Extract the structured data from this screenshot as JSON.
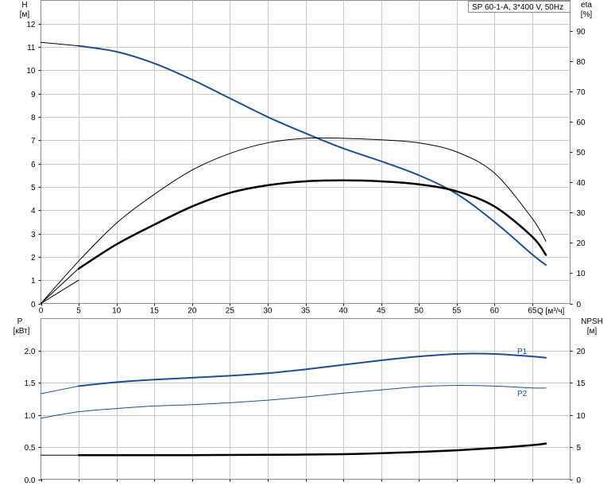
{
  "title": "SP 60-1-A, 3*400 V, 50Hz",
  "colors": {
    "blue": "#1f4e8c",
    "black": "#000000",
    "grid": "#c8c8c8"
  },
  "chart_data": [
    {
      "type": "line",
      "name": "head-efficiency",
      "xlabel": "Q [м³/ч]",
      "ylabel_left": {
        "name": "H",
        "unit": "[м]"
      },
      "ylabel_right": {
        "name": "eta",
        "unit": "[%]"
      },
      "xlim": [
        0,
        70
      ],
      "ylim_left": [
        0,
        13
      ],
      "ylim_right": [
        0,
        100
      ],
      "x_ticks": [
        "0",
        "5",
        "10",
        "15",
        "20",
        "25",
        "30",
        "35",
        "40",
        "45",
        "50",
        "55",
        "60",
        "65"
      ],
      "y_ticks_left": [
        "0",
        "1",
        "2",
        "3",
        "4",
        "5",
        "6",
        "7",
        "8",
        "9",
        "10",
        "11",
        "12"
      ],
      "y_ticks_right": [
        "0",
        "10",
        "20",
        "30",
        "40",
        "50",
        "60",
        "70",
        "80",
        "90"
      ],
      "grid": true,
      "series": [
        {
          "axis": "left",
          "color": "#1f4e8c",
          "width": 2,
          "x": [
            5,
            10,
            15,
            20,
            25,
            30,
            35,
            40,
            45,
            50,
            55,
            60,
            65,
            66.8
          ],
          "y": [
            11.05,
            10.8,
            10.3,
            9.6,
            8.8,
            8.0,
            7.3,
            6.65,
            6.1,
            5.5,
            4.7,
            3.5,
            2.1,
            1.65
          ]
        },
        {
          "axis": "left",
          "color": "#000000",
          "width": 1,
          "x": [
            0,
            5,
            0
          ],
          "y": [
            11.2,
            11.05,
            11.2
          ]
        },
        {
          "axis": "right",
          "color": "#000000",
          "width": 1,
          "x": [
            0,
            5,
            10,
            15,
            20,
            25,
            30,
            35,
            40,
            45,
            50,
            55,
            60,
            65,
            66.8
          ],
          "y": [
            0,
            14,
            26.5,
            36,
            44,
            49.5,
            53,
            54.5,
            54.5,
            54,
            53,
            50,
            43,
            28,
            20.5
          ]
        },
        {
          "axis": "right",
          "color": "#000000",
          "width": 2.5,
          "x": [
            5,
            10,
            15,
            20,
            25,
            30,
            35,
            40,
            45,
            50,
            55,
            60,
            65,
            66.8
          ],
          "y": [
            11.5,
            19.5,
            26,
            32,
            36.5,
            39,
            40.3,
            40.6,
            40.3,
            39.3,
            37,
            32,
            22,
            16
          ]
        },
        {
          "axis": "left",
          "color": "#000000",
          "width": 1,
          "x": [
            0,
            5
          ],
          "y": [
            0,
            1.5
          ]
        },
        {
          "axis": "left",
          "color": "#000000",
          "width": 1,
          "x": [
            0,
            5
          ],
          "y": [
            0,
            1.0
          ]
        }
      ]
    },
    {
      "type": "line",
      "name": "power-npsh",
      "ylabel_left": {
        "name": "P",
        "unit": "[кВт]"
      },
      "ylabel_right": {
        "name": "NPSH",
        "unit": "[м]"
      },
      "xlim": [
        0,
        70
      ],
      "ylim_left": [
        0,
        2.5
      ],
      "ylim_right": [
        0,
        25
      ],
      "y_ticks_left": [
        "0.0",
        "0.5",
        "1.0",
        "1.5",
        "2.0"
      ],
      "y_ticks_right": [
        "0",
        "5",
        "10",
        "15",
        "20"
      ],
      "grid": true,
      "series": [
        {
          "name": "P1",
          "axis": "left",
          "color": "#1f4e8c",
          "width": 2,
          "x": [
            5,
            10,
            15,
            20,
            25,
            30,
            35,
            40,
            45,
            50,
            55,
            60,
            65,
            66.8
          ],
          "y": [
            1.45,
            1.51,
            1.55,
            1.58,
            1.61,
            1.65,
            1.71,
            1.78,
            1.85,
            1.91,
            1.95,
            1.95,
            1.91,
            1.89
          ]
        },
        {
          "axis": "left",
          "color": "#1f4e8c",
          "width": 1,
          "x": [
            0,
            5
          ],
          "y": [
            1.33,
            1.45
          ]
        },
        {
          "name": "P2",
          "axis": "left",
          "color": "#1f4e8c",
          "width": 1,
          "x": [
            0,
            5,
            10,
            15,
            20,
            25,
            30,
            35,
            40,
            45,
            50,
            55,
            60,
            65,
            66.8
          ],
          "y": [
            0.95,
            1.05,
            1.1,
            1.14,
            1.16,
            1.19,
            1.23,
            1.28,
            1.34,
            1.39,
            1.44,
            1.46,
            1.45,
            1.42,
            1.42
          ]
        },
        {
          "axis": "right",
          "color": "#000000",
          "width": 2.5,
          "x": [
            5,
            10,
            20,
            30,
            40,
            45,
            50,
            55,
            60,
            65,
            66.8
          ],
          "y": [
            3.75,
            3.75,
            3.75,
            3.8,
            3.9,
            4.05,
            4.25,
            4.5,
            4.85,
            5.3,
            5.55
          ]
        },
        {
          "axis": "right",
          "color": "#000000",
          "width": 1,
          "x": [
            0,
            5
          ],
          "y": [
            3.75,
            3.75
          ]
        }
      ]
    }
  ]
}
